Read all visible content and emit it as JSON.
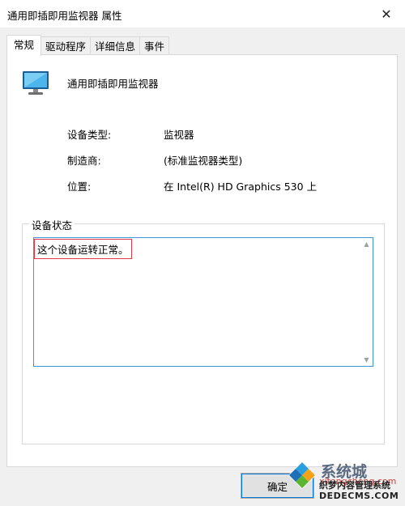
{
  "window": {
    "title": "通用即插即用监视器 属性",
    "close_glyph": "✕"
  },
  "tabs": [
    {
      "label": "常规",
      "active": true
    },
    {
      "label": "驱动程序",
      "active": false
    },
    {
      "label": "详细信息",
      "active": false
    },
    {
      "label": "事件",
      "active": false
    }
  ],
  "device": {
    "icon": "monitor-icon",
    "name": "通用即插即用监视器"
  },
  "properties": [
    {
      "label": "设备类型:",
      "value": "监视器"
    },
    {
      "label": "制造商:",
      "value": "(标准监视器类型)"
    },
    {
      "label": "位置:",
      "value": "在 Intel(R) HD Graphics 530 上"
    }
  ],
  "status": {
    "legend": "设备状态",
    "text": "这个设备运转正常。"
  },
  "buttons": {
    "ok_label": "确定"
  },
  "watermark": {
    "brand_cn": "系统城",
    "url": "xitongcheng.com",
    "line2": "织梦内容管理系统",
    "line3": "DEDECMS.COM"
  },
  "colors": {
    "accent": "#0078d7",
    "status_border": "#3c97d6",
    "highlight_box": "#e03a4a"
  }
}
